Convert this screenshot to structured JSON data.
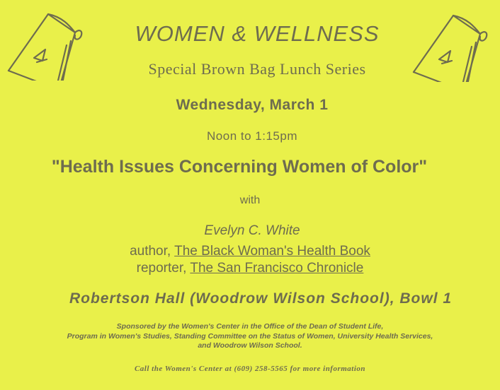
{
  "poster": {
    "title": "WOMEN & WELLNESS",
    "subtitle": "Special Brown Bag Lunch Series",
    "date": "Wednesday, March 1",
    "time": "Noon to 1:15pm",
    "talk_title": "\"Health Issues Concerning Women of Color\"",
    "with": "with",
    "speaker": "Evelyn C. White",
    "role_author": "author, ",
    "book": "The Black Woman's Health Book",
    "role_reporter": "reporter, ",
    "newspaper": "The San Francisco Chronicle",
    "venue": "Robertson Hall (Woodrow Wilson School), Bowl 1",
    "sponsor_lines": [
      "Sponsored by the Women's Center in the Office of the Dean of Student Life,",
      "Program in Women's Studies, Standing Committee on the Status of Women, University Health Services,",
      "and Woodrow Wilson School."
    ],
    "contact": "Call the Women's Center at (609) 258-5565 for more information"
  },
  "colors": {
    "paper": "#e9f04a",
    "ink": "#6e6c4f"
  },
  "icons": [
    "brown-bag-icon-left",
    "brown-bag-icon-right"
  ]
}
